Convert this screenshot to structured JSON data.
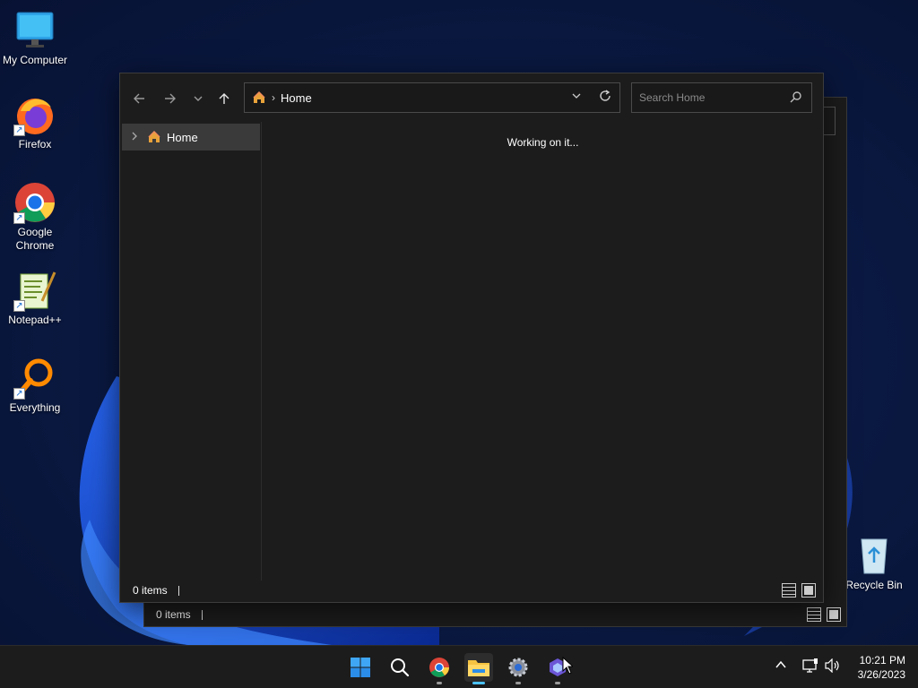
{
  "desktop": {
    "icons": [
      {
        "label": "My Computer",
        "icon": "monitor-icon"
      },
      {
        "label": "Firefox",
        "icon": "firefox-icon"
      },
      {
        "label": "Google Chrome",
        "icon": "chrome-icon"
      },
      {
        "label": "Notepad++",
        "icon": "notepadpp-icon"
      },
      {
        "label": "Everything",
        "icon": "everything-icon"
      },
      {
        "label": "Recycle Bin",
        "icon": "recycle-bin-icon"
      }
    ]
  },
  "explorer_back": {
    "status_items": "0 items"
  },
  "explorer": {
    "address": {
      "location": "Home",
      "separator": "›"
    },
    "search": {
      "placeholder": "Search Home"
    },
    "nav_pane": {
      "items": [
        {
          "label": "Home"
        }
      ]
    },
    "content": {
      "message": "Working on it..."
    },
    "status_items": "0 items"
  },
  "taskbar": {
    "apps": [
      {
        "name": "start",
        "icon": "windows-start-icon"
      },
      {
        "name": "search",
        "icon": "search-icon"
      },
      {
        "name": "chrome",
        "icon": "chrome-icon"
      },
      {
        "name": "file-explorer",
        "icon": "folder-icon"
      },
      {
        "name": "settings",
        "icon": "gear-icon"
      },
      {
        "name": "app",
        "icon": "app-icon"
      }
    ],
    "clock": {
      "time": "10:21 PM",
      "date": "3/26/2023"
    }
  },
  "colors": {
    "accent": "#4cc2ff",
    "window_bg": "#1c1c1c",
    "selection": "#3a3a3a"
  }
}
